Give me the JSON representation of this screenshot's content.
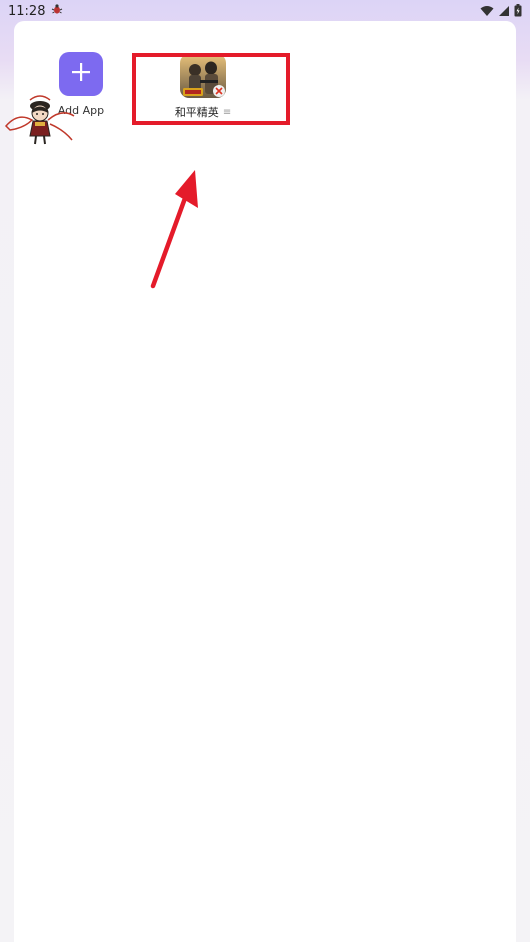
{
  "status_bar": {
    "time": "11:28"
  },
  "apps": {
    "add_app_label": "Add App",
    "game_label": "和平精英"
  },
  "icons": {
    "status_left": "bug-icon",
    "wifi": "wifi-icon",
    "signal": "cell-signal-icon",
    "battery": "battery-icon",
    "add": "plus-icon",
    "more": "more-icon"
  },
  "colors": {
    "accent": "#7d6af0",
    "highlight": "#e41b2a"
  }
}
